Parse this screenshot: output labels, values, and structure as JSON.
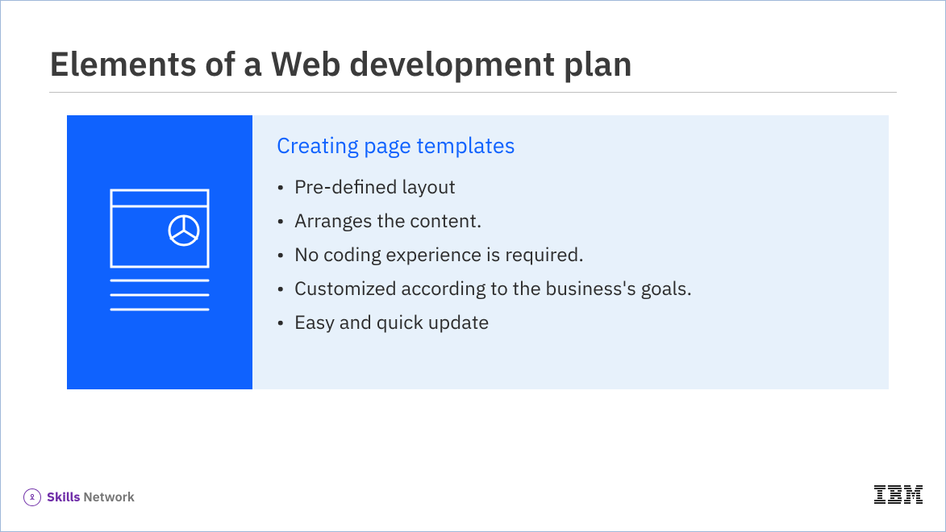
{
  "title": "Elements of a Web development plan",
  "section": {
    "heading": "Creating page templates",
    "bullets": [
      "Pre-defined layout",
      "Arranges the content.",
      "No coding experience is required.",
      "Customized according to the business's goals.",
      "Easy and quick update"
    ]
  },
  "footer": {
    "skills_label_bold": "Skills",
    "skills_label_light": "Network",
    "right_logo": "IBM"
  },
  "icons": {
    "panel_icon": "page-template-icon",
    "skills_badge": "skills-badge-icon"
  },
  "colors": {
    "accent_blue": "#0f62fe",
    "panel_bg": "#e7f1fb",
    "title_text": "#3b3b3b",
    "skills_purple": "#6f2da8"
  }
}
